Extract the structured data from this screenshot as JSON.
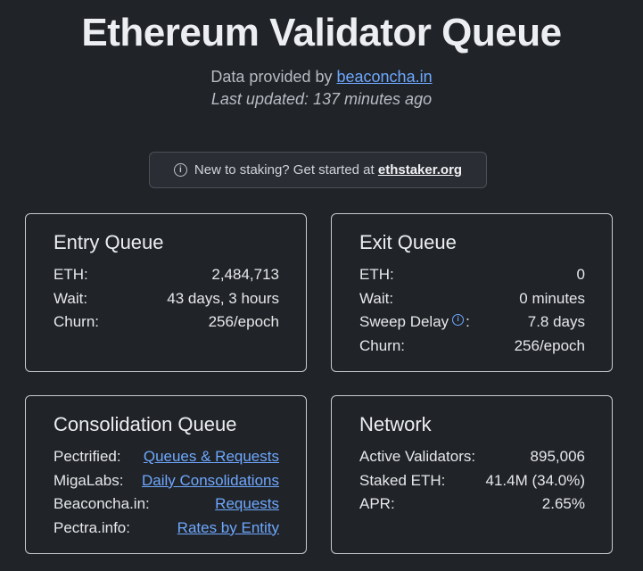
{
  "header": {
    "title": "Ethereum Validator Queue",
    "provided_by_prefix": "Data provided by ",
    "provider_link": "beaconcha.in",
    "last_updated": "Last updated: 137 minutes ago"
  },
  "notice": {
    "icon": "info-icon",
    "text": "New to staking? Get started at ",
    "link": "ethstaker.org"
  },
  "entry_queue": {
    "title": "Entry Queue",
    "rows": [
      {
        "label": "ETH:",
        "value": "2,484,713"
      },
      {
        "label": "Wait:",
        "value": "43 days, 3 hours"
      },
      {
        "label": "Churn:",
        "value": "256/epoch"
      }
    ]
  },
  "exit_queue": {
    "title": "Exit Queue",
    "rows": [
      {
        "label": "ETH:",
        "value": "0"
      },
      {
        "label": "Wait:",
        "value": "0 minutes"
      },
      {
        "label": "Sweep Delay",
        "suffix": ":",
        "value": "7.8 days",
        "icon": "info-icon"
      },
      {
        "label": "Churn:",
        "value": "256/epoch"
      }
    ]
  },
  "consolidation_queue": {
    "title": "Consolidation Queue",
    "rows": [
      {
        "label": "Pectrified:",
        "value": "Queues & Requests"
      },
      {
        "label": "MigaLabs:",
        "value": "Daily Consolidations"
      },
      {
        "label": "Beaconcha.in:",
        "value": "Requests"
      },
      {
        "label": "Pectra.info:",
        "value": "Rates by Entity"
      }
    ]
  },
  "network": {
    "title": "Network",
    "rows": [
      {
        "label": "Active Validators:",
        "value": "895,006"
      },
      {
        "label": "Staked ETH:",
        "value": "41.4M (34.0%)"
      },
      {
        "label": "APR:",
        "value": "2.65%"
      }
    ]
  },
  "colors": {
    "background": "#202327",
    "link": "#6ea8ff",
    "card_border": "#c8ccd2"
  }
}
